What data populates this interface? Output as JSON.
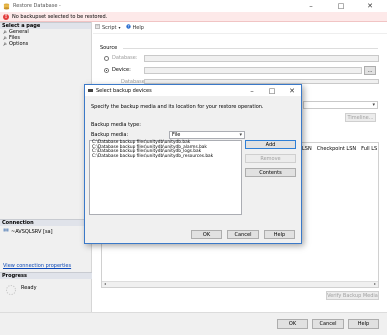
{
  "window": {
    "title": "Restore Database -",
    "minimize": "–",
    "maximize": "□",
    "close": "✕"
  },
  "error": {
    "icon": "!",
    "text": "No backupset selected to be restored."
  },
  "left": {
    "select_page_header": "Select a page",
    "pages": [
      "General",
      "Files",
      "Options"
    ],
    "connection_header": "Connection",
    "connection_server": "~AVSQLSRV [sa]",
    "view_connection_link": "View connection properties",
    "progress_header": "Progress",
    "progress_status": "Ready"
  },
  "toolbar": {
    "script_label": "Script",
    "help_label": "Help"
  },
  "main": {
    "source_label": "Source",
    "database_radio": "Database:",
    "device_radio": "Device:",
    "database_sub_label": "Database:",
    "browse_glyph": "...",
    "timeline_button": "Timeline...",
    "grid_headers": [
      "LSN",
      "Checkpoint LSN",
      "Full LS"
    ],
    "verify_button": "Verify Backup Media"
  },
  "dialog": {
    "title": "Select backup devices",
    "minimize": "–",
    "maximize": "□",
    "close": "✕",
    "instruction": "Specify the backup media and its location for your restore operation.",
    "media_type_label": "Backup media type:",
    "media_type_value": "File",
    "backup_media_label": "Backup media:",
    "files": [
      "C:\\Database backup files\\unitydb\\unitydb.bak",
      "C:\\Database backup files\\unitydb\\unitydb_alarms.bak",
      "C:\\Database backup files\\unitydb\\unitydb_logs.bak",
      "C:\\Database backup files\\unitydb\\unitydb_resources.bak"
    ],
    "add_button": "Add",
    "remove_button": "Remove",
    "contents_button": "Contents",
    "ok_button": "OK",
    "cancel_button": "Cancel",
    "help_button": "Help"
  },
  "footer": {
    "ok_button": "OK",
    "cancel_button": "Cancel",
    "help_button": "Help"
  }
}
